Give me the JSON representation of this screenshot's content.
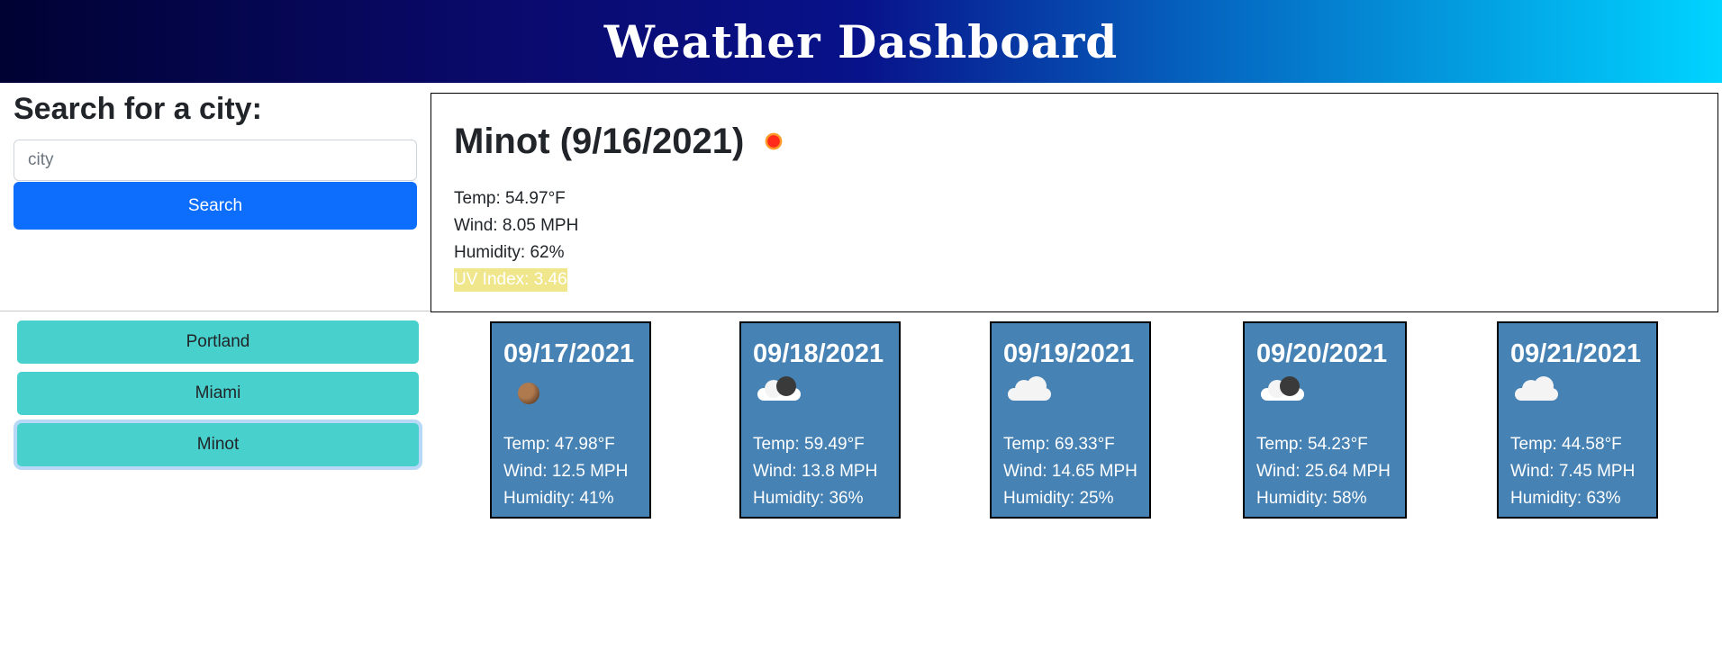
{
  "header": {
    "title": "Weather Dashboard"
  },
  "search": {
    "title": "Search for a city:",
    "placeholder": "city",
    "button_label": "Search"
  },
  "current": {
    "title": "Minot (9/16/2021)",
    "icon": "sun-icon",
    "temp": "Temp: 54.97°F",
    "wind": "Wind: 8.05 MPH",
    "humidity": "Humidity: 62%",
    "uv": "UV Index: 3.46",
    "uv_color": "#f0e68c"
  },
  "history": [
    {
      "label": "Portland"
    },
    {
      "label": "Miami"
    },
    {
      "label": "Minot"
    }
  ],
  "forecast": [
    {
      "date": "09/17/2021",
      "icon": "moon-icon",
      "temp": "Temp: 47.98°F",
      "wind": "Wind: 12.5 MPH",
      "humidity": "Humidity: 41%"
    },
    {
      "date": "09/18/2021",
      "icon": "cloud-dark-icon",
      "temp": "Temp: 59.49°F",
      "wind": "Wind: 13.8 MPH",
      "humidity": "Humidity: 36%"
    },
    {
      "date": "09/19/2021",
      "icon": "cloud-icon",
      "temp": "Temp: 69.33°F",
      "wind": "Wind: 14.65 MPH",
      "humidity": "Humidity: 25%"
    },
    {
      "date": "09/20/2021",
      "icon": "cloud-dark-icon",
      "temp": "Temp: 54.23°F",
      "wind": "Wind: 25.64 MPH",
      "humidity": "Humidity: 58%"
    },
    {
      "date": "09/21/2021",
      "icon": "cloud-icon",
      "temp": "Temp: 44.58°F",
      "wind": "Wind: 7.45 MPH",
      "humidity": "Humidity: 63%"
    }
  ],
  "colors": {
    "card": "#4682b4",
    "history_button": "#48d1cc",
    "search_button": "#0d6efd"
  }
}
